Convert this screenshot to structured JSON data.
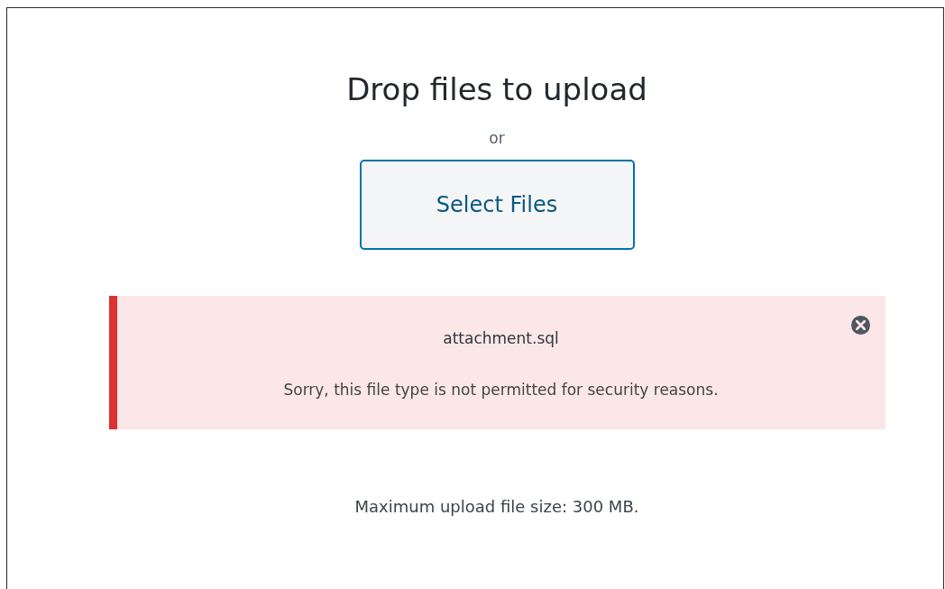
{
  "title": "Drop files to upload",
  "separator": "or",
  "select_button": "Select Files",
  "error": {
    "filename": "attachment.sql",
    "message": "Sorry, this file type is not permitted for security reasons.",
    "dismissible": true
  },
  "max_size": "Maximum upload file size: 300 MB."
}
